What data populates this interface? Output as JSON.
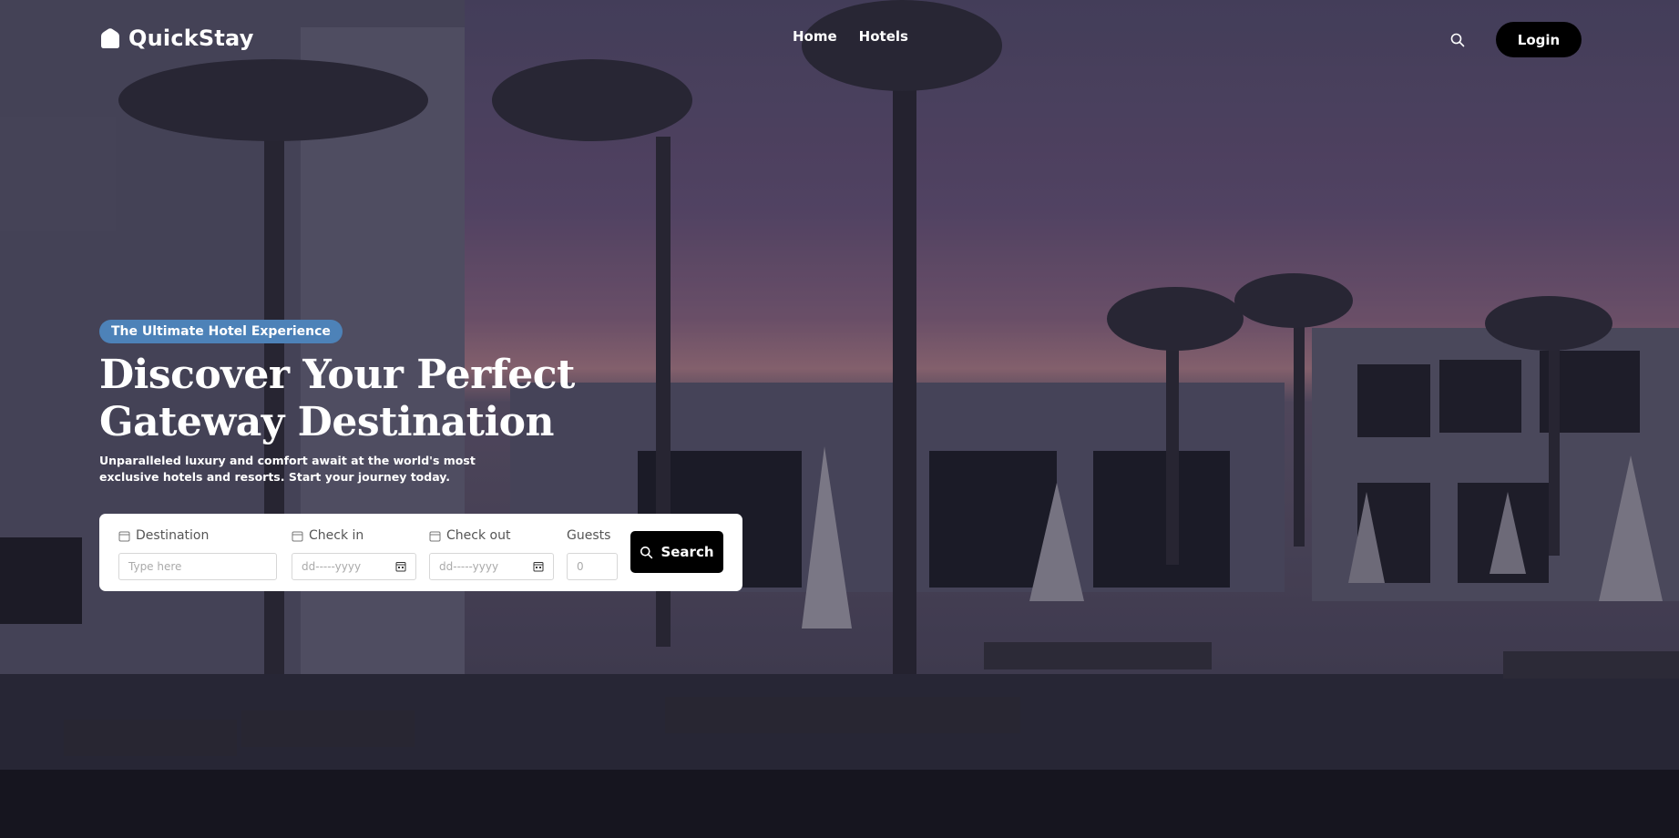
{
  "brand": {
    "name": "QuickStay",
    "logo_icon": "house-icon"
  },
  "nav": {
    "links": [
      "Home",
      "Hotels"
    ],
    "search_icon": "search-icon",
    "login_label": "Login"
  },
  "hero": {
    "badge": "The Ultimate Hotel Experience",
    "headline": "Discover Your Perfect Gateway Destination",
    "subtitle": "Unparalleled luxury and comfort await at the world's most exclusive hotels and resorts. Start your journey today."
  },
  "search_form": {
    "destination": {
      "label": "Destination",
      "placeholder": "Type here",
      "icon": "calendar-icon"
    },
    "check_in": {
      "label": "Check in",
      "placeholder": "dd-----yyyy",
      "icon": "calendar-icon"
    },
    "check_out": {
      "label": "Check out",
      "placeholder": "dd-----yyyy",
      "icon": "calendar-icon"
    },
    "guests": {
      "label": "Guests",
      "placeholder": "0"
    },
    "submit_label": "Search"
  },
  "colors": {
    "badge": "#4d82b8",
    "button": "#000000",
    "form_bg": "#ffffff"
  }
}
